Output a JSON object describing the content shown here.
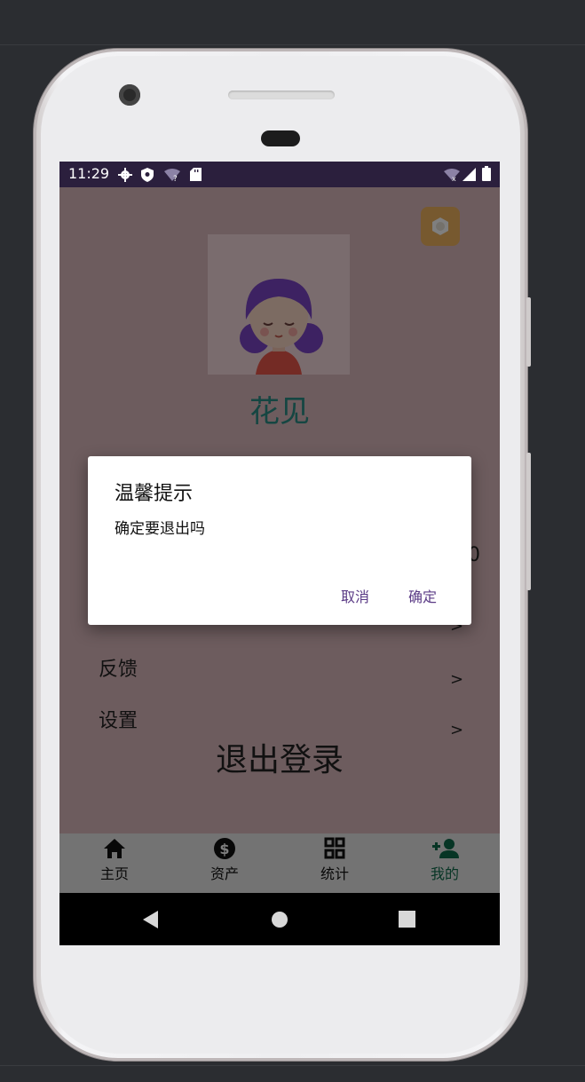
{
  "status_bar": {
    "time": "11:29",
    "left_icons": [
      "gear-icon",
      "shield-icon",
      "wifi-question-icon",
      "sd-card-icon"
    ],
    "right_icons": [
      "wifi-off-icon",
      "signal-icon",
      "battery-icon"
    ]
  },
  "profile": {
    "username": "花见",
    "avatar": "girl-avatar-illustration"
  },
  "menu": {
    "partial_value": "0",
    "items": [
      {
        "label": "反馈",
        "arrow": ">"
      },
      {
        "label": "设置",
        "arrow": ">"
      }
    ],
    "hidden_arrow": ">",
    "logout_label": "退出登录"
  },
  "bottom_nav": [
    {
      "label": "主页",
      "icon": "home-icon",
      "active": false
    },
    {
      "label": "资产",
      "icon": "dollar-icon",
      "active": false
    },
    {
      "label": "统计",
      "icon": "grid-icon",
      "active": false
    },
    {
      "label": "我的",
      "icon": "person-add-icon",
      "active": true
    }
  ],
  "dialog": {
    "title": "温馨提示",
    "message": "确定要退出吗",
    "cancel_label": "取消",
    "confirm_label": "确定"
  },
  "colors": {
    "content_bg": "#dbb8bc",
    "status_bar": "#2b1f3d",
    "dialog_button": "#5b3b86",
    "active_nav": "#0e6b4a",
    "username": "#2b8c85",
    "settings_button": "#efb35f"
  }
}
